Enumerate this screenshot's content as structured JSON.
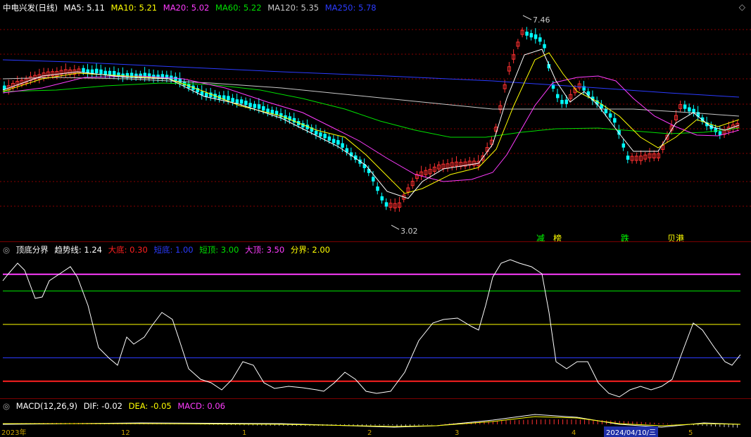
{
  "main": {
    "title": "中电兴发(日线)",
    "ma_items": [
      {
        "label": "MA5: 5.11",
        "color": "#ffffff"
      },
      {
        "label": "MA10: 5.21",
        "color": "#ffff00"
      },
      {
        "label": "MA20: 5.02",
        "color": "#ff3cff"
      },
      {
        "label": "MA60: 5.22",
        "color": "#00e000"
      },
      {
        "label": "MA120: 5.35",
        "color": "#c8c8c8"
      },
      {
        "label": "MA250: 5.78",
        "color": "#2b3bff"
      }
    ],
    "high_label": "7.46",
    "low_label": "3.02",
    "signals": [
      {
        "text": "减",
        "color": "#00ff00"
      },
      {
        "text": "榜",
        "color": "#ffff00"
      },
      {
        "text": "跌",
        "color": "#00ff00"
      },
      {
        "text": "贝港",
        "color": "#ffff00"
      }
    ]
  },
  "indicator": {
    "name": "顶底分界",
    "items": [
      {
        "label": "趋势线: 1.24",
        "color": "#ffffff"
      },
      {
        "label": "大底: 0.30",
        "color": "#ff2020"
      },
      {
        "label": "短底: 1.00",
        "color": "#2b3bff"
      },
      {
        "label": "短顶: 3.00",
        "color": "#00e000"
      },
      {
        "label": "大顶: 3.50",
        "color": "#ff3cff"
      },
      {
        "label": "分界: 2.00",
        "color": "#ffff00"
      }
    ],
    "levels": [
      {
        "name": "大底",
        "value": 0.3,
        "color": "#ff2020"
      },
      {
        "name": "短底",
        "value": 1.0,
        "color": "#2b3bff"
      },
      {
        "name": "分界",
        "value": 2.0,
        "color": "#ffff00"
      },
      {
        "name": "短顶",
        "value": 3.0,
        "color": "#00e000"
      },
      {
        "name": "大顶",
        "value": 3.5,
        "color": "#ff3cff"
      }
    ]
  },
  "macd": {
    "name": "MACD(12,26,9)",
    "items": [
      {
        "label": "DIF: -0.02",
        "color": "#ffffff"
      },
      {
        "label": "DEA: -0.05",
        "color": "#ffff00"
      },
      {
        "label": "MACD: 0.06",
        "color": "#ff3cff"
      }
    ]
  },
  "x_axis": {
    "labels": [
      "2023年",
      "12",
      "1",
      "2",
      "3",
      "4",
      "5"
    ],
    "selected_date": "2024/04/10/三"
  },
  "colors": {
    "up": "#ff3030",
    "down": "#00ffff",
    "grid": "#8a0000"
  }
}
